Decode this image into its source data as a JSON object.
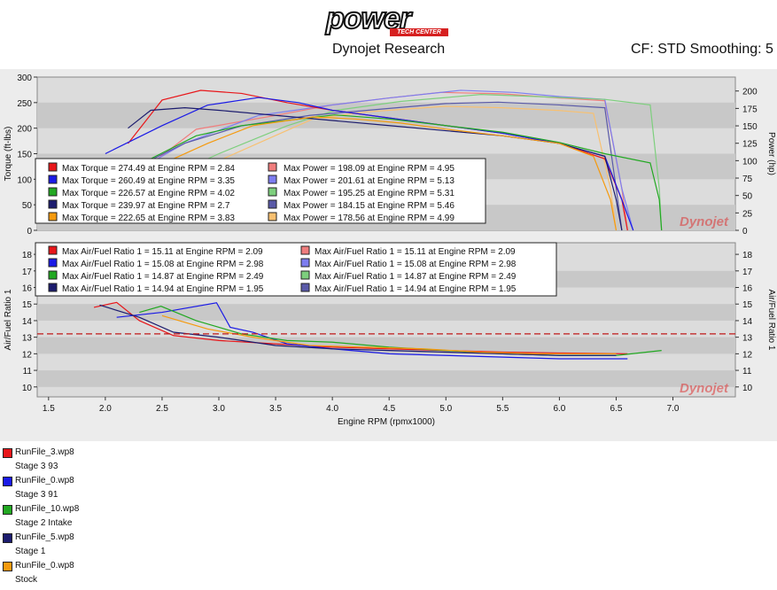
{
  "logo": {
    "main": "power",
    "sub": "TECH CENTER"
  },
  "header": {
    "company": "Dynojet Research",
    "cf": "CF: STD Smoothing: 5"
  },
  "colors": {
    "red": "#e8161a",
    "blue": "#1a1ae6",
    "green": "#22a822",
    "navy": "#1c1c6e",
    "orange": "#f59a0e",
    "light_red": "#f07d7d",
    "light_blue": "#7d7df0",
    "light_green": "#7dcf7d",
    "light_navy": "#5a5aa8",
    "light_orange": "#f8c070",
    "afr_target": "#c01818",
    "plot_bg": "#dcdcdc",
    "band": "#c8c8c8"
  },
  "chart_data": {
    "type": "line",
    "xlabel": "Engine RPM (rpmx1000)",
    "xticks": [
      "1.5",
      "2.0",
      "2.5",
      "3.0",
      "3.5",
      "4.0",
      "4.5",
      "5.0",
      "5.5",
      "6.0",
      "6.5",
      "7.0"
    ],
    "xlim": [
      1.4,
      7.55
    ],
    "top": {
      "ylabel_left": "Torque (ft-lbs)",
      "ylabel_right": "Power (hp)",
      "ylim_left": [
        0,
        300
      ],
      "ylim_right": [
        0,
        220
      ],
      "yticks_left": [
        "0",
        "50",
        "100",
        "150",
        "200",
        "250",
        "300"
      ],
      "yticks_right": [
        "0",
        "25",
        "50",
        "75",
        "100",
        "125",
        "150",
        "175",
        "200"
      ],
      "legend_torque": [
        "Max Torque = 274.49 at Engine RPM = 2.84",
        "Max Torque = 260.49 at Engine RPM = 3.35",
        "Max Torque = 226.57 at Engine RPM = 4.02",
        "Max Torque = 239.97 at Engine RPM = 2.7",
        "Max Torque = 222.65 at Engine RPM = 3.83"
      ],
      "legend_power": [
        "Max Power = 198.09 at Engine RPM = 4.95",
        "Max Power = 201.61 at Engine RPM = 5.13",
        "Max Power = 195.25 at Engine RPM = 5.31",
        "Max Power = 184.15 at Engine RPM = 5.46",
        "Max Power = 178.56 at Engine RPM = 4.99"
      ],
      "torque_series": [
        {
          "color": "red",
          "x": [
            2.2,
            2.5,
            2.84,
            3.2,
            3.6,
            4.0,
            4.5,
            5.0,
            5.5,
            6.0,
            6.4,
            6.55,
            6.6
          ],
          "y": [
            170,
            255,
            274,
            268,
            250,
            235,
            220,
            205,
            190,
            170,
            140,
            60,
            0
          ]
        },
        {
          "color": "blue",
          "x": [
            2.0,
            2.5,
            2.9,
            3.35,
            3.7,
            4.0,
            4.5,
            5.0,
            5.5,
            6.0,
            6.4,
            6.55,
            6.65
          ],
          "y": [
            150,
            205,
            245,
            260,
            250,
            235,
            220,
            205,
            190,
            170,
            145,
            60,
            0
          ]
        },
        {
          "color": "green",
          "x": [
            2.4,
            2.8,
            3.2,
            3.6,
            4.02,
            4.5,
            5.0,
            5.5,
            6.0,
            6.4,
            6.8,
            6.88,
            6.9
          ],
          "y": [
            140,
            185,
            205,
            215,
            226,
            218,
            205,
            192,
            172,
            150,
            132,
            60,
            0
          ]
        },
        {
          "color": "navy",
          "x": [
            2.2,
            2.4,
            2.7,
            3.0,
            3.5,
            4.0,
            4.5,
            5.0,
            5.5,
            6.0,
            6.4,
            6.5,
            6.55
          ],
          "y": [
            200,
            235,
            240,
            235,
            225,
            215,
            205,
            195,
            185,
            170,
            145,
            60,
            0
          ]
        },
        {
          "color": "orange",
          "x": [
            2.5,
            2.9,
            3.3,
            3.83,
            4.2,
            4.6,
            5.0,
            5.5,
            6.0,
            6.3,
            6.45,
            6.5
          ],
          "y": [
            130,
            170,
            205,
            222,
            218,
            210,
            198,
            185,
            170,
            145,
            60,
            0
          ]
        }
      ],
      "power_series": [
        {
          "color": "light_red",
          "x": [
            2.2,
            2.8,
            3.5,
            4.0,
            4.5,
            4.95,
            5.5,
            6.0,
            6.4,
            6.55,
            6.6
          ],
          "y": [
            70,
            145,
            165,
            180,
            190,
            198,
            196,
            190,
            186,
            60,
            0
          ]
        },
        {
          "color": "light_blue",
          "x": [
            2.0,
            2.7,
            3.35,
            4.0,
            4.5,
            5.13,
            5.6,
            6.0,
            6.4,
            6.55,
            6.65
          ],
          "y": [
            60,
            125,
            165,
            180,
            190,
            201,
            198,
            192,
            188,
            60,
            0
          ]
        },
        {
          "color": "light_green",
          "x": [
            2.4,
            3.0,
            3.6,
            4.02,
            4.6,
            5.31,
            5.8,
            6.4,
            6.8,
            6.88,
            6.9
          ],
          "y": [
            65,
            110,
            150,
            172,
            185,
            195,
            192,
            188,
            180,
            60,
            0
          ]
        },
        {
          "color": "light_navy",
          "x": [
            2.2,
            2.7,
            3.2,
            3.8,
            4.5,
            5.0,
            5.46,
            6.0,
            6.4,
            6.5,
            6.55
          ],
          "y": [
            85,
            125,
            150,
            165,
            175,
            182,
            184,
            180,
            176,
            60,
            0
          ]
        },
        {
          "color": "light_orange",
          "x": [
            2.5,
            3.0,
            3.83,
            4.3,
            4.99,
            5.5,
            6.0,
            6.3,
            6.45,
            6.5
          ],
          "y": [
            62,
            100,
            160,
            170,
            178,
            176,
            172,
            168,
            60,
            0
          ]
        }
      ]
    },
    "bottom": {
      "ylabel": "Air/Fuel Ratio 1",
      "ylim": [
        9.4,
        18.7
      ],
      "yticks": [
        "10",
        "11",
        "12",
        "13",
        "14",
        "15",
        "16",
        "17",
        "18"
      ],
      "target_afr": 13.2,
      "legend_a": [
        "Max Air/Fuel Ratio 1 = 15.11 at Engine RPM = 2.09",
        "Max Air/Fuel Ratio 1 = 15.08 at Engine RPM = 2.98",
        "Max Air/Fuel Ratio 1 = 14.87 at Engine RPM = 2.49",
        "Max Air/Fuel Ratio 1 = 14.94 at Engine RPM = 1.95"
      ],
      "legend_b": [
        "Max Air/Fuel Ratio 1 = 15.11 at Engine RPM = 2.09",
        "Max Air/Fuel Ratio 1 = 15.08 at Engine RPM = 2.98",
        "Max Air/Fuel Ratio 1 = 14.87 at Engine RPM = 2.49",
        "Max Air/Fuel Ratio 1 = 14.94 at Engine RPM = 1.95"
      ],
      "series": [
        {
          "color": "red",
          "x": [
            1.9,
            2.1,
            2.3,
            2.6,
            3.0,
            3.5,
            4.0,
            4.5,
            5.0,
            5.5,
            6.0,
            6.6
          ],
          "y": [
            14.8,
            15.1,
            14.0,
            13.1,
            12.8,
            12.6,
            12.4,
            12.3,
            12.2,
            12.1,
            12.05,
            12.0
          ]
        },
        {
          "color": "blue",
          "x": [
            2.1,
            2.5,
            2.98,
            3.1,
            3.3,
            3.6,
            4.0,
            4.5,
            5.0,
            5.5,
            6.0,
            6.6
          ],
          "y": [
            14.2,
            14.5,
            15.08,
            13.6,
            13.3,
            12.6,
            12.3,
            12.0,
            11.9,
            11.8,
            11.7,
            11.7
          ]
        },
        {
          "color": "green",
          "x": [
            2.3,
            2.49,
            2.8,
            3.2,
            3.6,
            4.0,
            4.5,
            5.0,
            5.5,
            6.0,
            6.5,
            6.9
          ],
          "y": [
            14.5,
            14.87,
            14.0,
            13.2,
            12.8,
            12.7,
            12.4,
            12.2,
            12.0,
            11.9,
            11.9,
            12.2
          ]
        },
        {
          "color": "navy",
          "x": [
            1.95,
            2.3,
            2.6,
            3.0,
            3.5,
            4.0,
            4.5,
            5.0,
            5.5,
            6.0,
            6.5
          ],
          "y": [
            14.94,
            14.2,
            13.3,
            13.0,
            12.5,
            12.3,
            12.2,
            12.1,
            12.0,
            11.9,
            11.9
          ]
        },
        {
          "color": "orange",
          "x": [
            2.5,
            2.9,
            3.3,
            3.8,
            4.3,
            4.8,
            5.3,
            5.8,
            6.3,
            6.5
          ],
          "y": [
            14.3,
            13.5,
            13.0,
            12.5,
            12.4,
            12.3,
            12.1,
            12.0,
            12.0,
            12.0
          ]
        }
      ]
    }
  },
  "watermark": "Dynojet",
  "runs": [
    {
      "file": "RunFile_3.wp8",
      "desc": "Stage 3 93",
      "color": "red"
    },
    {
      "file": "RunFile_0.wp8",
      "desc": "Stage 3 91",
      "color": "blue"
    },
    {
      "file": "RunFile_10.wp8",
      "desc": "Stage 2 Intake",
      "color": "green"
    },
    {
      "file": "RunFile_5.wp8",
      "desc": "Stage 1",
      "color": "navy"
    },
    {
      "file": "RunFile_0.wp8",
      "desc": "Stock",
      "color": "orange"
    }
  ]
}
